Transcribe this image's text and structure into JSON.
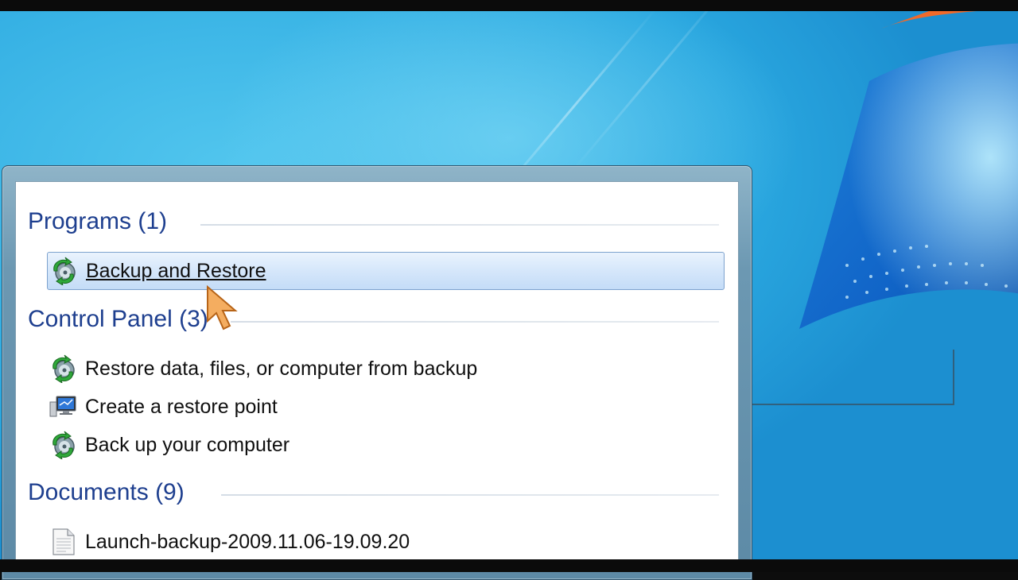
{
  "start_search": {
    "groups": [
      {
        "title": "Programs (1)",
        "items": [
          {
            "label": "Backup and Restore",
            "icon": "backup-restore-icon",
            "selected": true
          }
        ]
      },
      {
        "title": "Control Panel (3)",
        "items": [
          {
            "label": "Restore data, files, or computer from backup",
            "icon": "backup-restore-icon"
          },
          {
            "label": "Create a restore point",
            "icon": "system-monitor-icon"
          },
          {
            "label": "Back up your computer",
            "icon": "backup-restore-icon"
          }
        ]
      },
      {
        "title": "Documents (9)",
        "items": [
          {
            "label": "Launch-backup-2009.11.06-19.09.20",
            "icon": "text-document-icon"
          }
        ]
      }
    ]
  },
  "colors": {
    "header_text": "#1e3f8f",
    "selection_border": "#7da2ce",
    "desktop_blue": "#2aa8e0"
  }
}
